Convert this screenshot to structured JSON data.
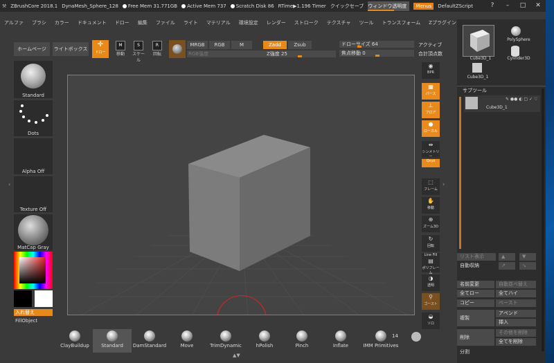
{
  "titlebar": {
    "app": "ZBrushCore 2018.1",
    "doc": "DynaMesh_Sphere_128",
    "free_mem": "Free Mem 31.771GB",
    "active_mem": "Active Mem 737",
    "scratch": "Scratch Disk 86",
    "rtime": "RTime▶1.196 Timer",
    "quicksave": "クイックセーブ",
    "transparency": "ウィンドウ透明度",
    "menus": "Menus",
    "zscript": "DefaultZScript",
    "ctl_help": "?",
    "ctl_min": "–",
    "ctl_max": "□",
    "ctl_close": "✕"
  },
  "menubar": [
    "アルファ",
    "ブラシ",
    "カラー",
    "ドキュメント",
    "ドロー",
    "編集",
    "ファイル",
    "ライト",
    "マテリアル",
    "環境設定",
    "レンダー",
    "ストローク",
    "テクスチャ",
    "ツール",
    "トランスフォーム",
    "Zプラグイン"
  ],
  "toolbar": {
    "home": "ホームページ",
    "lightbox": "ライトボックス",
    "draw": "ドロー",
    "move": "移動",
    "scale": "スケール",
    "rotate": "回転",
    "mrgb": "MRGB",
    "rgb": "RGB",
    "m": "M",
    "rgb_intensity": "RGB強度",
    "zadd": "Zadd",
    "zsub": "Zsub",
    "z_intensity": "Z強度 25",
    "draw_size": "ドローサイズ 64",
    "focal_shift": "焦点移動 0",
    "active": "アクティブ",
    "total_points": "合計頂点数"
  },
  "leftshelf": {
    "brush": "Standard",
    "stroke": "Dots",
    "alpha": "Alpha Off",
    "texture": "Texture Off",
    "material": "MatCap Gray",
    "switch": "入れ替え",
    "fill": "FillObject"
  },
  "rightshelf": [
    "BPR",
    "パース",
    "フロア",
    "ローカル",
    "シンメトリー",
    "Qxyz",
    "フレーム",
    "移動",
    "ズーム3D",
    "回転",
    "Line Fill",
    "ポリフレーム",
    "透明",
    "ゴースト",
    "ソロ"
  ],
  "tray": {
    "tools": [
      "Cube3D_1",
      "PolySphere",
      "Cylinder3D",
      "Cube3D_1"
    ],
    "subtool_title": "サブツール",
    "subtool_name": "Cube3D_1",
    "list_view": "リスト表示",
    "auto_collapse": "自動収納",
    "rename": "名前変更",
    "autoreorder": "自動並べ替え",
    "all_low": "全てロー",
    "all_high": "全てハイ",
    "copy": "コピー",
    "paste": "ペースト",
    "duplicate": "複製",
    "append": "アペンド",
    "insert": "挿入",
    "delete": "削除",
    "del_other": "その他を削除",
    "del_all": "全てを削除",
    "split": "分割"
  },
  "brushes": [
    "ClayBuildup",
    "Standard",
    "DamStandard",
    "Move",
    "TrimDynamic",
    "hPolish",
    "Pinch",
    "Inflate",
    "IMM Primitives"
  ],
  "brush_count": "14",
  "colors": {
    "accent": "#e88a1a",
    "panel": "#3a3a3a",
    "viewport": "#444444"
  }
}
